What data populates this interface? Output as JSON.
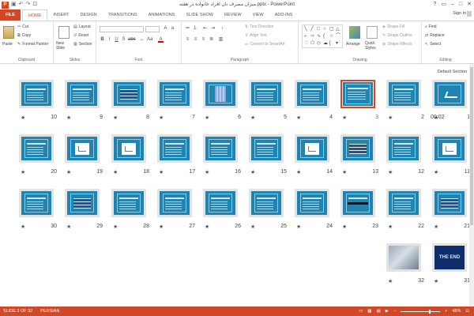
{
  "window": {
    "title": "میزان مصرف نان افراد خانواده در هفته.pptx - PowerPoint",
    "controls": [
      "?",
      "▭",
      "–",
      "□",
      "✕"
    ]
  },
  "qat": {
    "undo": "↶",
    "redo": "↷",
    "start": "⊡"
  },
  "ribbon_tabs": [
    "FILE",
    "HOME",
    "INSERT",
    "DESIGN",
    "TRANSITIONS",
    "ANIMATIONS",
    "SLIDE SHOW",
    "REVIEW",
    "VIEW",
    "ADD-INS"
  ],
  "active_tab": "HOME",
  "signin": "Sign in",
  "ribbon": {
    "clipboard": {
      "label": "Clipboard",
      "paste": "Paste",
      "cut": "Cut",
      "copy": "Copy",
      "format_painter": "Format Painter"
    },
    "slides": {
      "label": "Slides",
      "new_slide": "New Slide",
      "layout": "Layout",
      "reset": "Reset",
      "section": "Section"
    },
    "font": {
      "label": "Font"
    },
    "paragraph": {
      "label": "Paragraph",
      "text_direction": "Text Direction",
      "align_text": "Align Text",
      "convert_smartart": "Convert to SmartArt"
    },
    "drawing": {
      "label": "Drawing",
      "arrange": "Arrange",
      "quick_styles": "Quick Styles",
      "shape_fill": "Shape Fill",
      "shape_outline": "Shape Outline",
      "shape_effects": "Shape Effects"
    },
    "editing": {
      "label": "Editing",
      "find": "Find",
      "replace": "Replace",
      "select": "Select"
    }
  },
  "section_label": "Default Section",
  "slides": [
    {
      "num": "1",
      "kind": "logo",
      "timing": "00:02"
    },
    {
      "num": "2",
      "kind": "text"
    },
    {
      "num": "3",
      "kind": "text",
      "selected": true
    },
    {
      "num": "4",
      "kind": "text"
    },
    {
      "num": "5",
      "kind": "text"
    },
    {
      "num": "6",
      "kind": "cols"
    },
    {
      "num": "7",
      "kind": "text"
    },
    {
      "num": "8",
      "kind": "table"
    },
    {
      "num": "9",
      "kind": "text"
    },
    {
      "num": "10",
      "kind": "text"
    },
    {
      "num": "11",
      "kind": "white"
    },
    {
      "num": "12",
      "kind": "text"
    },
    {
      "num": "13",
      "kind": "table"
    },
    {
      "num": "14",
      "kind": "white"
    },
    {
      "num": "15",
      "kind": "text"
    },
    {
      "num": "16",
      "kind": "text"
    },
    {
      "num": "17",
      "kind": "text"
    },
    {
      "num": "18",
      "kind": "white"
    },
    {
      "num": "19",
      "kind": "white"
    },
    {
      "num": "20",
      "kind": "text"
    },
    {
      "num": "21",
      "kind": "table"
    },
    {
      "num": "22",
      "kind": "text"
    },
    {
      "num": "23",
      "kind": "band"
    },
    {
      "num": "24",
      "kind": "text"
    },
    {
      "num": "25",
      "kind": "text"
    },
    {
      "num": "26",
      "kind": "text"
    },
    {
      "num": "27",
      "kind": "text"
    },
    {
      "num": "28",
      "kind": "text"
    },
    {
      "num": "29",
      "kind": "table"
    },
    {
      "num": "30",
      "kind": "text"
    },
    {
      "num": "31",
      "kind": "end",
      "end_text": "THE END"
    },
    {
      "num": "32",
      "kind": "photo"
    }
  ],
  "status": {
    "slide_info": "SLIDE 3 OF 32",
    "language": "PERSIAN",
    "zoom": "48%"
  },
  "colors": {
    "accent": "#d24726",
    "slide_bg": "#1e84b1"
  }
}
